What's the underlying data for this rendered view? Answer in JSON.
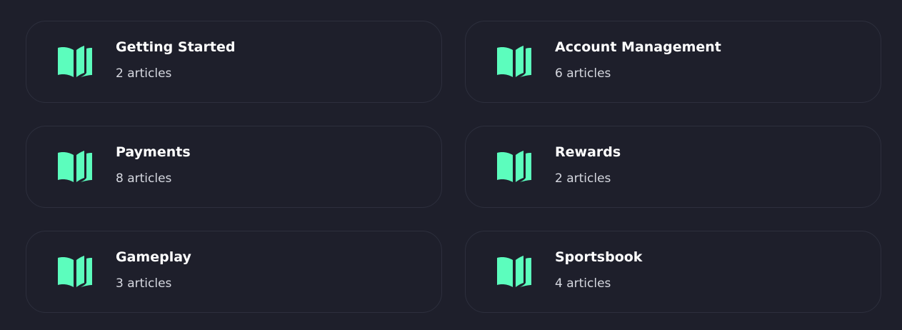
{
  "accent_color": "#5cfdbd",
  "icon": "open-book-icon",
  "categories": [
    {
      "title": "Getting Started",
      "count": "2 articles"
    },
    {
      "title": "Account Management",
      "count": "6 articles"
    },
    {
      "title": "Payments",
      "count": "8 articles"
    },
    {
      "title": "Rewards",
      "count": "2 articles"
    },
    {
      "title": "Gameplay",
      "count": "3 articles"
    },
    {
      "title": "Sportsbook",
      "count": "4 articles"
    }
  ]
}
